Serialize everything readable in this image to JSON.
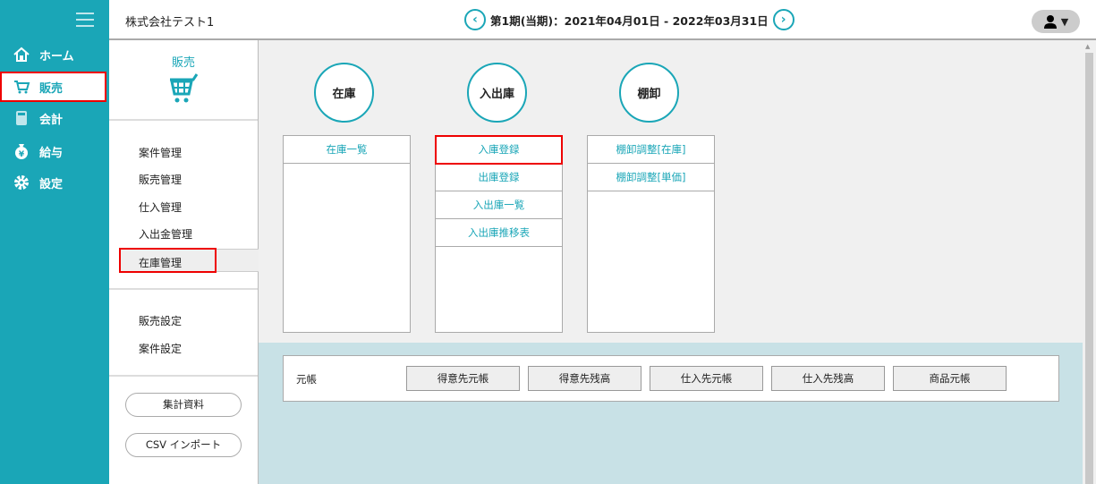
{
  "sidebar": {
    "items": [
      {
        "label": "ホーム",
        "icon": "home-icon"
      },
      {
        "label": "販売",
        "icon": "cart-icon"
      },
      {
        "label": "会計",
        "icon": "calculator-icon"
      },
      {
        "label": "給与",
        "icon": "money-bag-icon"
      },
      {
        "label": "設定",
        "icon": "gear-icon"
      }
    ]
  },
  "header": {
    "company": "株式会社テスト1",
    "period": "第1期(当期)：2021年04月01日 - 2022年03月31日",
    "prev": "‹",
    "next": "›"
  },
  "submenu": {
    "title": "販売",
    "items": [
      "案件管理",
      "販売管理",
      "仕入管理",
      "入出金管理",
      "在庫管理"
    ],
    "settings": [
      "販売設定",
      "案件設定"
    ],
    "buttons": [
      "集計資料",
      "CSV インポート"
    ]
  },
  "sections": [
    {
      "title": "在庫",
      "links": [
        "在庫一覧"
      ]
    },
    {
      "title": "入出庫",
      "links": [
        "入庫登録",
        "出庫登録",
        "入出庫一覧",
        "入出庫推移表"
      ]
    },
    {
      "title": "棚卸",
      "links": [
        "棚卸調整[在庫]",
        "棚卸調整[単価]"
      ]
    }
  ],
  "ledger": {
    "label": "元帳",
    "buttons": [
      "得意先元帳",
      "得意先残高",
      "仕入先元帳",
      "仕入先残高",
      "商品元帳"
    ]
  },
  "colors": {
    "accent": "#1aa6b7",
    "highlight": "#e00000"
  }
}
